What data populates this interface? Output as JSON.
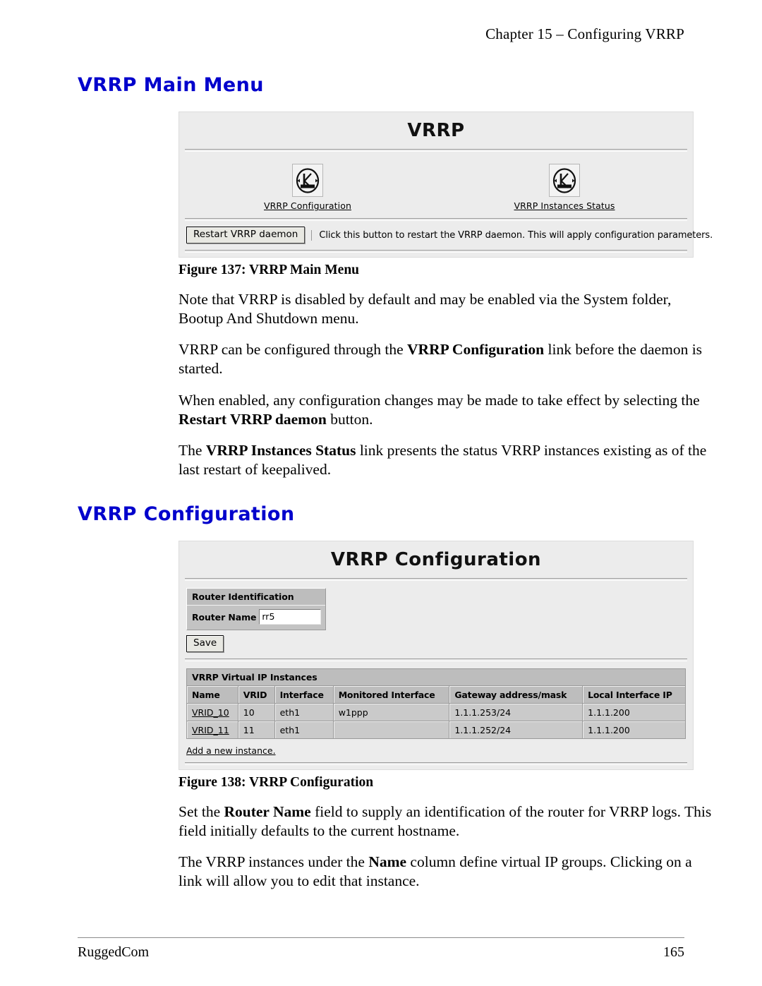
{
  "page": {
    "running_header": "Chapter 15 – Configuring VRRP",
    "footer_left": "RuggedCom",
    "footer_right": "165",
    "heading_color": "#0000cc"
  },
  "section_main_menu": {
    "heading": "VRRP Main Menu",
    "figure_caption": "Figure 137: VRRP Main Menu",
    "screenshot": {
      "title": "VRRP",
      "icon_links": [
        {
          "label": "VRRP Configuration",
          "icon": "keepalived-logo-icon"
        },
        {
          "label": "VRRP Instances Status",
          "icon": "keepalived-logo-icon"
        }
      ],
      "restart_button": "Restart VRRP daemon",
      "restart_note": "Click this button to restart the VRRP daemon. This will apply configuration parameters."
    },
    "paragraphs": [
      {
        "runs": [
          {
            "t": "Note that VRRP is disabled by default and may be enabled via the System folder, Bootup And Shutdown menu.",
            "b": false
          }
        ]
      },
      {
        "runs": [
          {
            "t": "VRRP can be configured through the ",
            "b": false
          },
          {
            "t": "VRRP Configuration",
            "b": true
          },
          {
            "t": " link before the daemon is started.",
            "b": false
          }
        ]
      },
      {
        "runs": [
          {
            "t": "When enabled, any configuration changes may be made to take effect by selecting the ",
            "b": false
          },
          {
            "t": "Restart VRRP daemon",
            "b": true
          },
          {
            "t": " button.",
            "b": false
          }
        ]
      },
      {
        "runs": [
          {
            "t": "The ",
            "b": false
          },
          {
            "t": "VRRP Instances Status",
            "b": true
          },
          {
            "t": " link presents the status VRRP instances existing as of the last restart of keepalived.",
            "b": false
          }
        ]
      }
    ]
  },
  "section_config": {
    "heading": "VRRP Configuration",
    "figure_caption": "Figure 138: VRRP Configuration",
    "screenshot": {
      "title": "VRRP Configuration",
      "router_identification": {
        "group_title": "Router Identification",
        "router_name_label": "Router Name",
        "router_name_value": "rr5",
        "save_button": "Save"
      },
      "instances_table": {
        "caption": "VRRP Virtual IP Instances",
        "columns": [
          "Name",
          "VRID",
          "Interface",
          "Monitored Interface",
          "Gateway address/mask",
          "Local Interface IP"
        ],
        "rows": [
          {
            "name": "VRID_10",
            "vrid": "10",
            "interface": "eth1",
            "monitored": "w1ppp",
            "gateway": "1.1.1.253/24",
            "local_ip": "1.1.1.200"
          },
          {
            "name": "VRID_11",
            "vrid": "11",
            "interface": "eth1",
            "monitored": "",
            "gateway": "1.1.1.252/24",
            "local_ip": "1.1.1.200"
          }
        ],
        "add_link": "Add a new instance."
      }
    },
    "paragraphs": [
      {
        "runs": [
          {
            "t": "Set the ",
            "b": false
          },
          {
            "t": "Router Name",
            "b": true
          },
          {
            "t": " field to supply an identification of the router for VRRP logs. This field initially defaults to the current hostname.",
            "b": false
          }
        ]
      },
      {
        "runs": [
          {
            "t": "The VRRP instances under the ",
            "b": false
          },
          {
            "t": "Name",
            "b": true
          },
          {
            "t": " column define virtual IP groups. Clicking on a link will allow you to edit that instance.",
            "b": false
          }
        ]
      }
    ]
  }
}
